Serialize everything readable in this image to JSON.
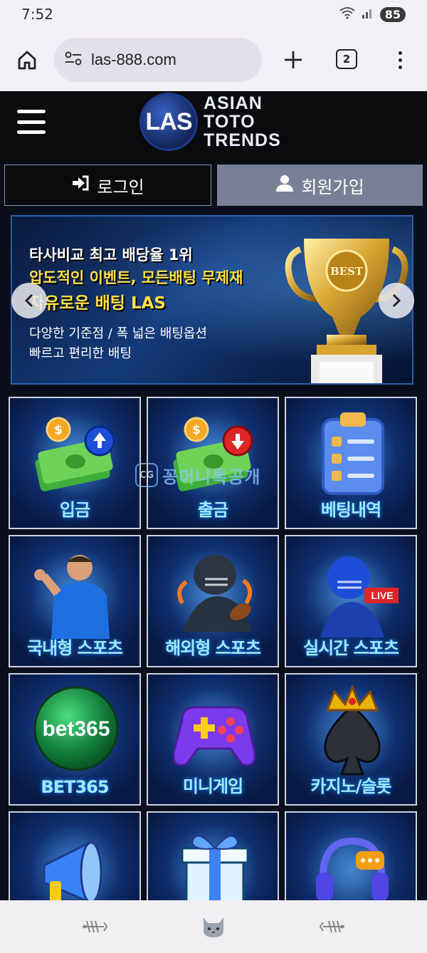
{
  "status_bar": {
    "time": "7:52",
    "battery": "85"
  },
  "browser": {
    "url": "las-888.com",
    "tab_count": "2"
  },
  "site": {
    "logo_mark": "LAS",
    "logo_lines": [
      "ASIAN",
      "TOTO",
      "TRENDS"
    ],
    "login_label": "로그인",
    "signup_label": "회원가입"
  },
  "banner": {
    "line1": "타사비교 최고 배당율 1위",
    "line2": "압도적인 이벤트, 모든배팅 무제재",
    "line3": "자유로운 배팅 LAS",
    "line4": "다양한 기준점 / 폭 넓은 배팅옵션",
    "line5": "빠르고 편리한 배팅",
    "trophy_text": "BEST"
  },
  "tiles": [
    {
      "label": "입금",
      "icon": "cash-deposit-icon"
    },
    {
      "label": "출금",
      "icon": "cash-withdraw-icon"
    },
    {
      "label": "베팅내역",
      "icon": "clipboard-icon"
    },
    {
      "label": "국내형 스포츠",
      "icon": "soccer-player-icon"
    },
    {
      "label": "해외형 스포츠",
      "icon": "football-player-icon"
    },
    {
      "label": "실시간 스포츠",
      "icon": "live-football-icon",
      "badge": "LIVE"
    },
    {
      "label": "BET365",
      "icon": "bet365-logo",
      "logo_text": "bet365"
    },
    {
      "label": "미니게임",
      "icon": "gamepad-icon"
    },
    {
      "label": "카지노/슬롯",
      "icon": "spade-crown-icon"
    },
    {
      "label": "",
      "icon": "megaphone-icon"
    },
    {
      "label": "",
      "icon": "gift-icon"
    },
    {
      "label": "",
      "icon": "headset-icon"
    }
  ],
  "watermark": {
    "text": "꽁머니톡공개"
  },
  "colors": {
    "tile_label": "#9fe8ff",
    "banner_yellow": "#fde047",
    "join_button": "#778094"
  }
}
